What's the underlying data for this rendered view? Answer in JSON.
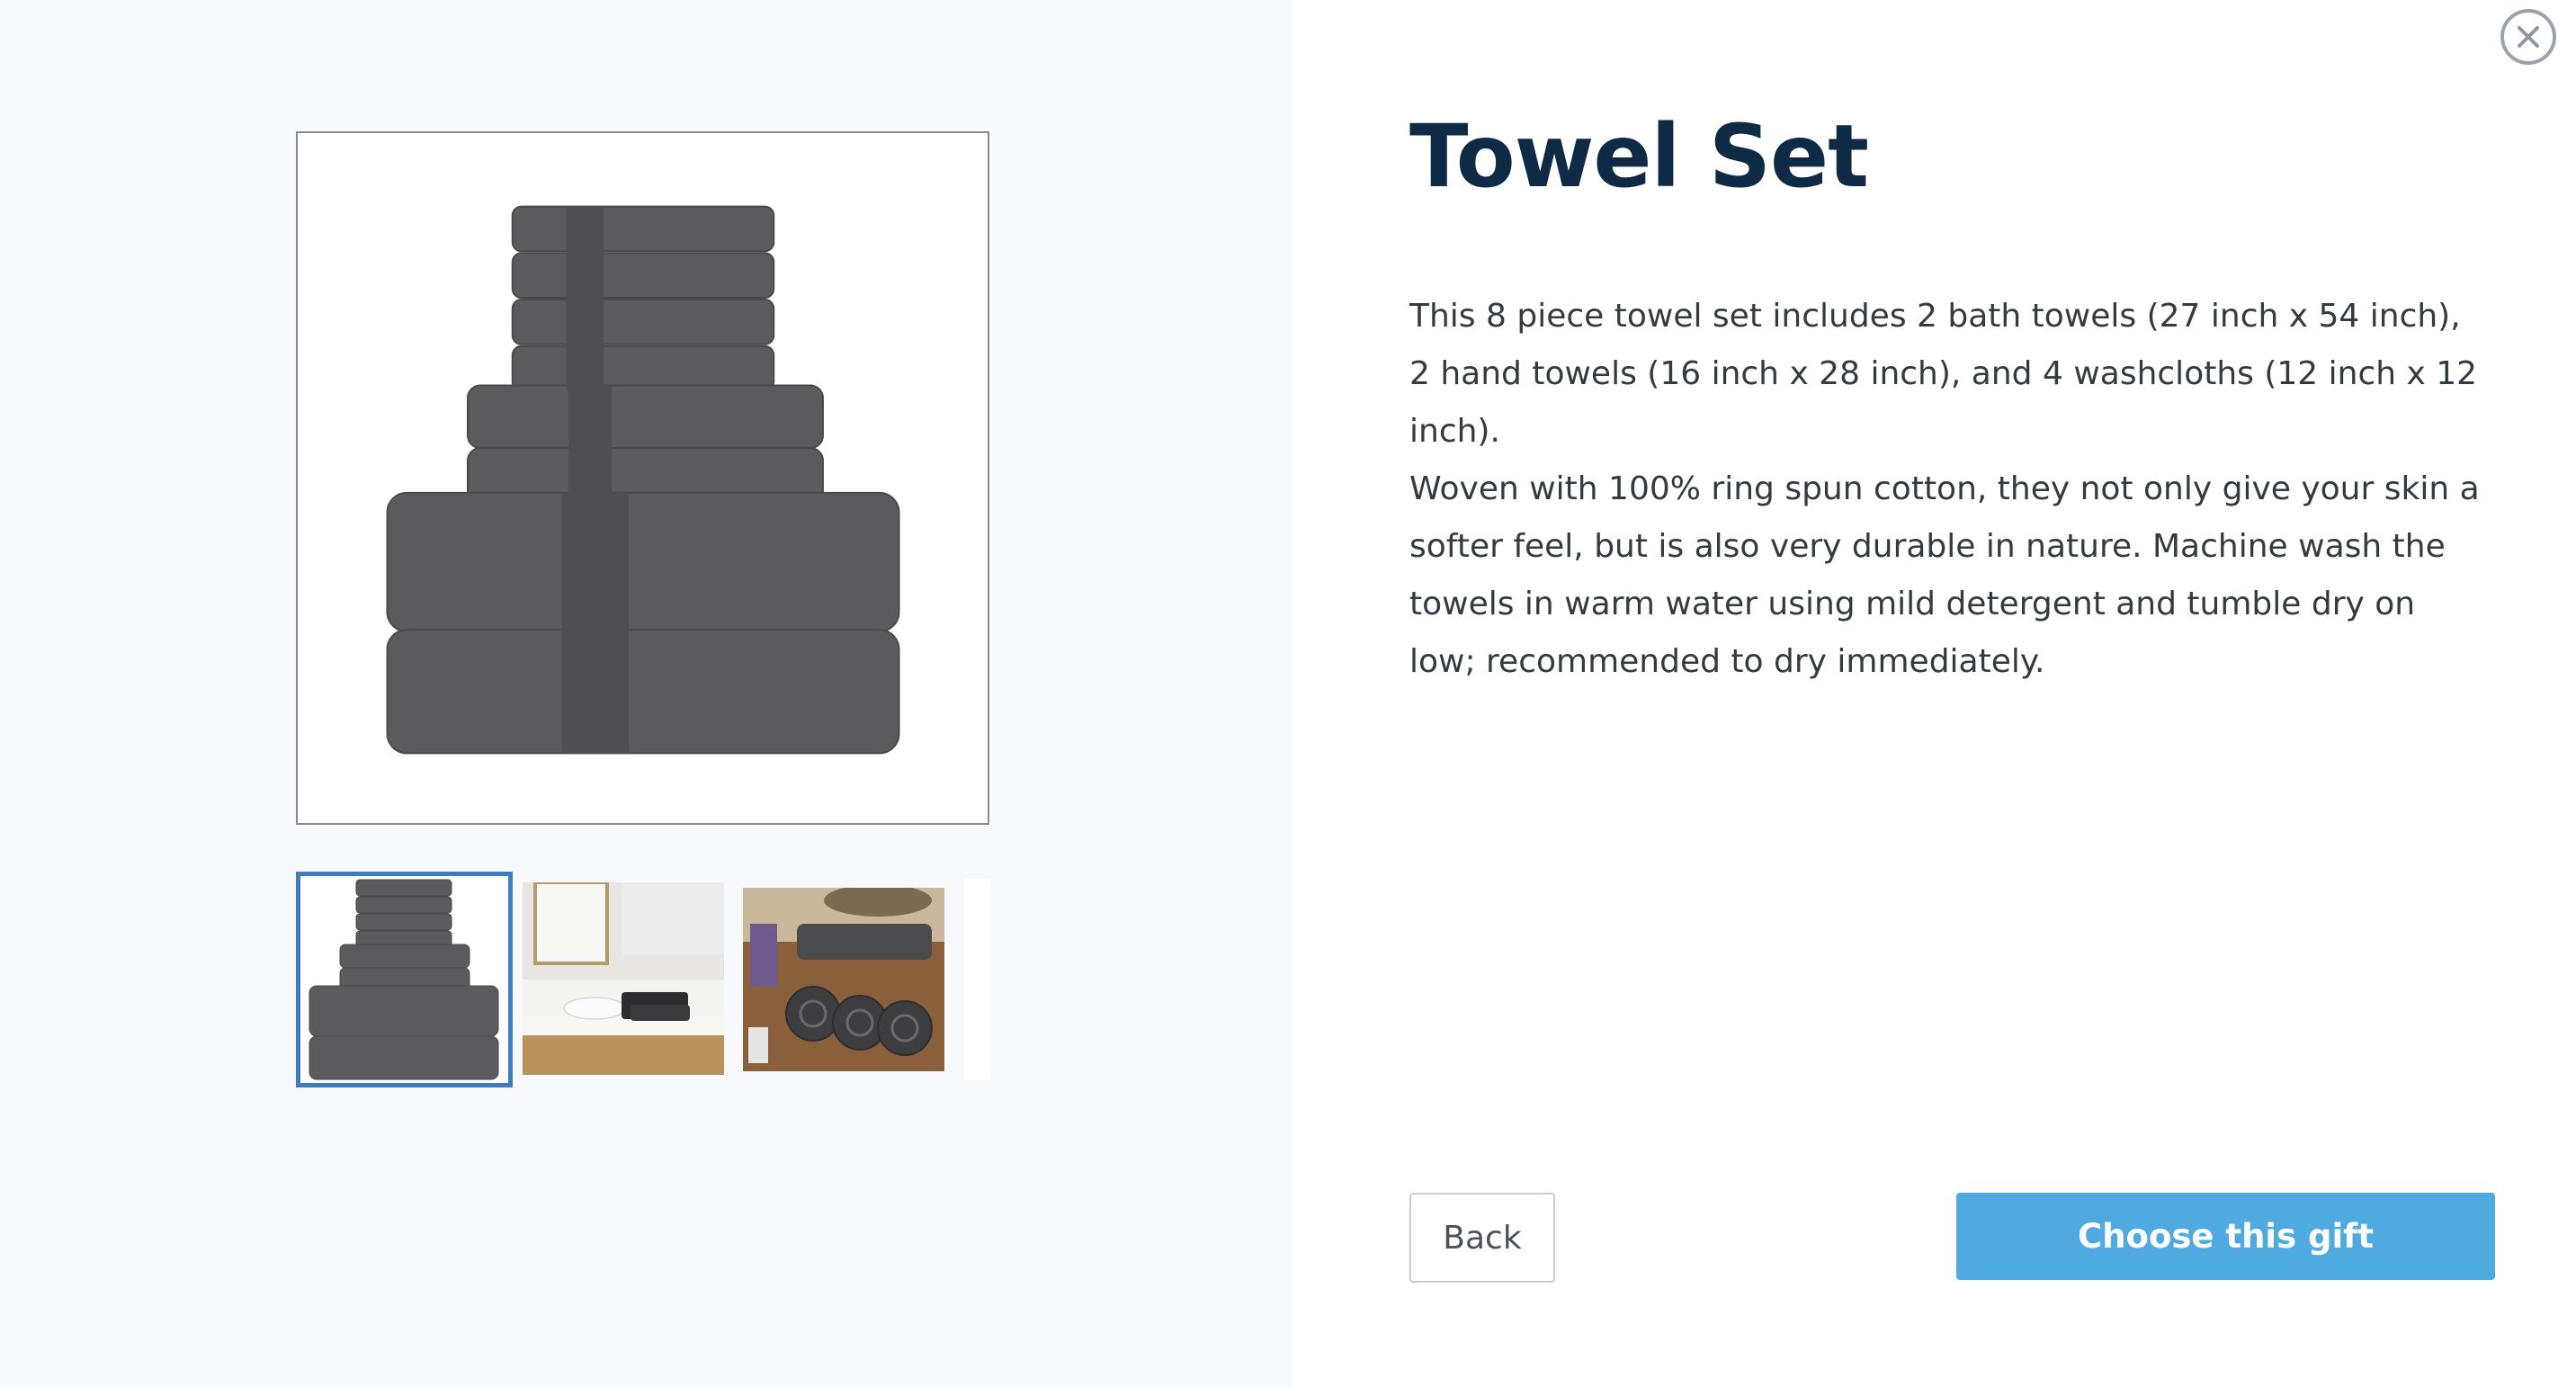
{
  "product": {
    "title": "Towel Set",
    "description_paragraphs": [
      "This 8 piece towel set includes 2 bath towels (27 inch x 54 inch), 2 hand towels (16 inch x 28 inch), and 4 washcloths (12 inch x 12 inch).",
      "Woven with 100% ring spun cotton, they not only give your skin a softer feel, but is also very durable in nature. Machine wash the towels in warm water using mild detergent and tumble dry on low; recommended to dry immediately."
    ]
  },
  "gallery": {
    "selected_index": 0,
    "thumbnails": [
      "towel-stack-thumbnail",
      "bathroom-counter-thumbnail",
      "rolled-towels-thumbnail",
      "partial-thumbnail"
    ]
  },
  "actions": {
    "back_label": "Back",
    "choose_label": "Choose this gift"
  },
  "icons": {
    "close": "close-icon"
  },
  "colors": {
    "title": "#0f2a44",
    "accent_button": "#4eaadf",
    "selected_thumb_border": "#3f7bbf",
    "left_panel_bg": "#f7f9fd"
  }
}
